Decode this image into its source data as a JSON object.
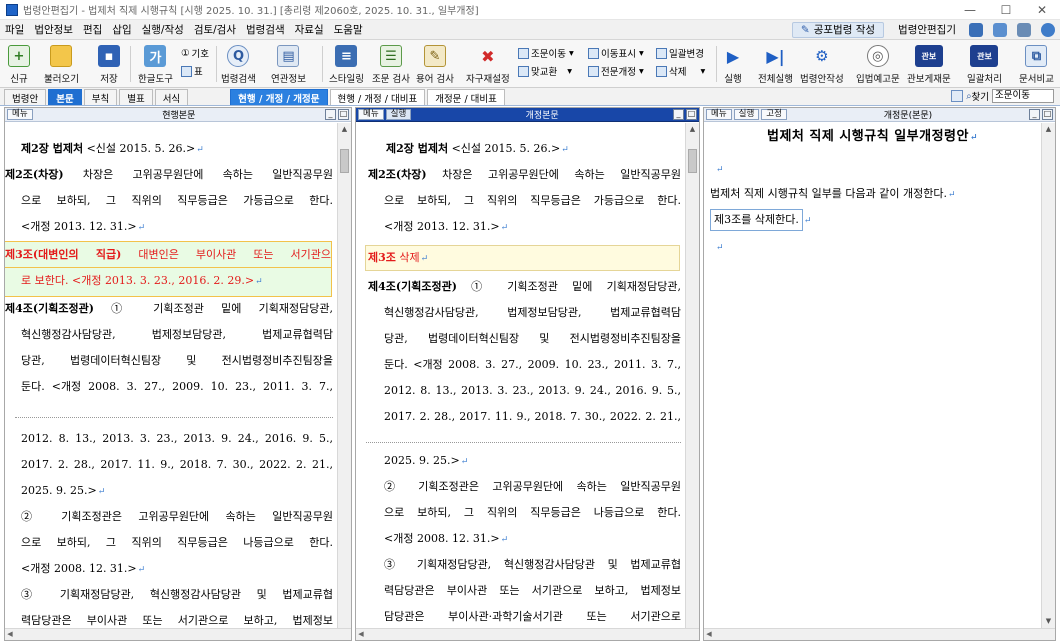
{
  "window": {
    "title": "법령안편집기 - 법제처 직제 시행규칙 [시행 2025. 10. 31.] [총리령 제2060호, 2025. 10. 31., 일부개정]",
    "minimize": "—",
    "maximize": "☐",
    "close": "✕"
  },
  "menu": {
    "items": [
      "파일",
      "법안정보",
      "편집",
      "삽입",
      "실행/작성",
      "검토/검사",
      "법령검색",
      "자료실",
      "도움말"
    ],
    "gongpo_button": "공포법령 작성",
    "app_name": "법령안편집기"
  },
  "toolbar": {
    "new": "신규",
    "open": "불러오기",
    "save": "저장",
    "hangul_tool": "한글도구",
    "symbol": "기호",
    "table": "표",
    "law_search": "법령검색",
    "related_info": "연관정보",
    "styling": "스타일링",
    "article_check": "조문 검사",
    "term_check": "용어 검사",
    "auto_number": "자구재설정",
    "article_move": "조문이동",
    "swap": "맞교환",
    "move_mark": "이동표시",
    "full_revision": "전문개정",
    "bulk_change": "일괄변경",
    "delete": "삭제",
    "run": "실행",
    "run_all": "전체실행",
    "draft": "법령안작성",
    "notice": "입법예고문",
    "gazette": "관보게재문",
    "batch": "일괄처리",
    "doc_compare": "문서비교",
    "gwanbo_icon_text": "관보"
  },
  "tabs": {
    "items": [
      "법령안",
      "본문",
      "부칙",
      "별표",
      "서식"
    ],
    "active": "본문",
    "compare_tabs": [
      "현행 / 개정 / 개정문",
      "현행 / 개정 / 대비표",
      "개정문 / 대비표"
    ],
    "find_label": "찾기",
    "find_value": "조문이동"
  },
  "panes": {
    "left": {
      "menu": "메뉴",
      "title": "현행본문",
      "lines": [
        {
          "text": "제2장 법제처 <신설 2015. 5. 26.>",
          "bold_prefix": "제2장 법제처"
        },
        {
          "text": "제2조(차장) 차장은 고위공무원단에 속하는 일반직공무원",
          "bold_prefix": "제2조(차장)"
        },
        {
          "text": "으로 보하되, 그 직위의 직무등급은 가등급으로 한다."
        },
        {
          "text": "<개정 2013. 12. 31.>"
        },
        {
          "text": "제3조(대변인의 직급) 대변인은 부이사관 또는 서기관으",
          "bold_prefix": "제3조(대변인의 직급)"
        },
        {
          "text": "로 보한다. <개정 2013. 3. 23., 2016. 2. 29.>"
        },
        {
          "text": "제4조(기획조정관) ① 기획조정관 밑에 기획재정담당관,",
          "bold_prefix": "제4조(기획조정관)"
        },
        {
          "text": "혁신행정감사담당관, 법제정보담당관, 법제교류협력담"
        },
        {
          "text": "당관, 법령데이터혁신팀장 및 전시법령정비추진팀장을"
        },
        {
          "text": "둔다. <개정 2008. 3. 27., 2009. 10. 23., 2011. 3. 7.,"
        },
        {
          "text": "2012. 8. 13., 2013. 3. 23., 2013. 9. 24., 2016. 9. 5.,"
        },
        {
          "text": "2017. 2. 28., 2017. 11. 9., 2018. 7. 30., 2022. 2. 21.,"
        },
        {
          "text": "2025. 9. 25.>"
        },
        {
          "text": "② 기획조정관은 고위공무원단에 속하는 일반직공무원"
        },
        {
          "text": "으로 보하되, 그 직위의 직무등급은 나등급으로 한다."
        },
        {
          "text": "<개정 2008. 12. 31.>"
        },
        {
          "text": "③ 기획재정담당관, 혁신행정감사담당관 및 법제교류협"
        },
        {
          "text": "력담당관은 부이사관 또는 서기관으로 보하고, 법제정보"
        }
      ]
    },
    "middle": {
      "menu": "메뉴",
      "run": "실행",
      "title": "개정본문",
      "lines": [
        {
          "text": "제2장 법제처 <신설 2015. 5. 26.>",
          "bold_prefix": "제2장 법제처"
        },
        {
          "text": "제2조(차장) 차장은 고위공무원단에 속하는 일반직공무원",
          "bold_prefix": "제2조(차장)"
        },
        {
          "text": "으로 보하되, 그 직위의 직무등급은 가등급으로 한다."
        },
        {
          "text": "<개정 2013. 12. 31.>"
        },
        {
          "text": "제3조 삭제",
          "bold_prefix": "제3조"
        },
        {
          "text": "제4조(기획조정관) ① 기획조정관 밑에 기획재정담당관,",
          "bold_prefix": "제4조(기획조정관)"
        },
        {
          "text": "혁신행정감사담당관, 법제정보담당관, 법제교류협력담"
        },
        {
          "text": "당관, 법령데이터혁신팀장 및 전시법령정비추진팀장을"
        },
        {
          "text": "둔다. <개정 2008. 3. 27., 2009. 10. 23., 2011. 3. 7.,"
        },
        {
          "text": "2012. 8. 13., 2013. 3. 23., 2013. 9. 24., 2016. 9. 5.,"
        },
        {
          "text": "2017. 2. 28., 2017. 11. 9., 2018. 7. 30., 2022. 2. 21.,"
        },
        {
          "text": "2025. 9. 25.>"
        },
        {
          "text": "② 기획조정관은 고위공무원단에 속하는 일반직공무원"
        },
        {
          "text": "으로 보하되, 그 직위의 직무등급은 나등급으로 한다."
        },
        {
          "text": "<개정 2008. 12. 31.>"
        },
        {
          "text": "③ 기획재정담당관, 혁신행정감사담당관 및 법제교류협"
        },
        {
          "text": "력담당관은 부이사관 또는 서기관으로 보하고, 법제정보"
        },
        {
          "text": "담당관은 부이사관·과학기술서기관 또는 서기관으로"
        }
      ]
    },
    "right": {
      "menu": "메뉴",
      "run": "실행",
      "fix": "고정",
      "title": "개정문(본문)",
      "doc_title": "법제처 직제 시행규칙 일부개정령안",
      "body": "법제처 직제 시행규칙 일부를 다음과 같이 개정한다.",
      "item": "제3조를 삭제한다."
    }
  },
  "colors": {
    "accent": "#1f6fd1",
    "deleted_red": "#e31b1b",
    "pane_header_blue": "#1847a8"
  }
}
